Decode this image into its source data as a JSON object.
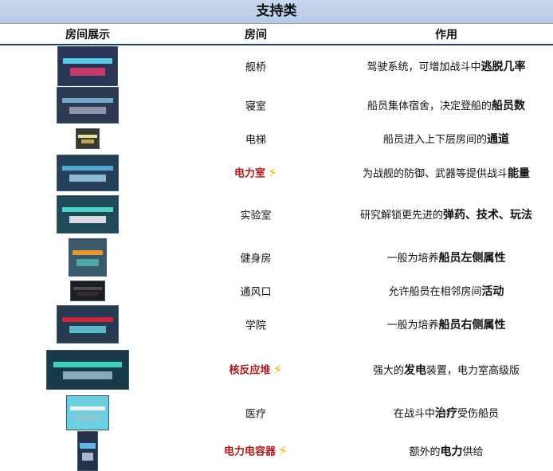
{
  "title": "支持类",
  "headers": {
    "showcase": "房间展示",
    "room": "房间",
    "function": "作用"
  },
  "rows": [
    {
      "name": "舰桥",
      "pre": "驾驶系统，可增加战斗中",
      "bold": "逃脱几率",
      "post": "",
      "accent": false,
      "bolt": false
    },
    {
      "name": "寝室",
      "pre": "船员集体宿舍，决定登船的",
      "bold": "船员数",
      "post": "",
      "accent": false,
      "bolt": false
    },
    {
      "name": "电梯",
      "pre": "船员进入上下层房间的",
      "bold": "通道",
      "post": "",
      "accent": false,
      "bolt": false
    },
    {
      "name": "电力室",
      "pre": "为战舰的防御、武器等提供战斗",
      "bold": "能量",
      "post": "",
      "accent": true,
      "bolt": true
    },
    {
      "name": "实验室",
      "pre": "研究解锁更先进的",
      "bold": "弹药、技术、玩法",
      "post": "",
      "accent": false,
      "bolt": false
    },
    {
      "name": "健身房",
      "pre": "一般为培养",
      "bold": "船员左侧属性",
      "post": "",
      "accent": false,
      "bolt": false
    },
    {
      "name": "通风口",
      "pre": "允许船员在相邻房间",
      "bold": "活动",
      "post": "",
      "accent": false,
      "bolt": false
    },
    {
      "name": "学院",
      "pre": "一般为培养",
      "bold": "船员右侧属性",
      "post": "",
      "accent": false,
      "bolt": false
    },
    {
      "name": "核反应堆",
      "pre": "强大的",
      "bold": "发电",
      "post": "装置，电力室高级版",
      "accent": true,
      "bolt": true
    },
    {
      "name": "医疗",
      "pre": "在战斗中",
      "bold": "治疗",
      "post": "受伤船员",
      "accent": false,
      "bolt": false
    },
    {
      "name": "电力电容器",
      "pre": "额外的",
      "bold": "电力",
      "post": "供给",
      "accent": true,
      "bolt": true
    }
  ],
  "colors": {
    "accent_text": "#b0181a",
    "bolt": "#f4b400",
    "title_bg": "#c3d4ec",
    "header_rule": "#1e3f7a"
  },
  "icons": {
    "room_image": "pixel-art-room-icon",
    "bolt": "lightning-bolt-icon"
  }
}
